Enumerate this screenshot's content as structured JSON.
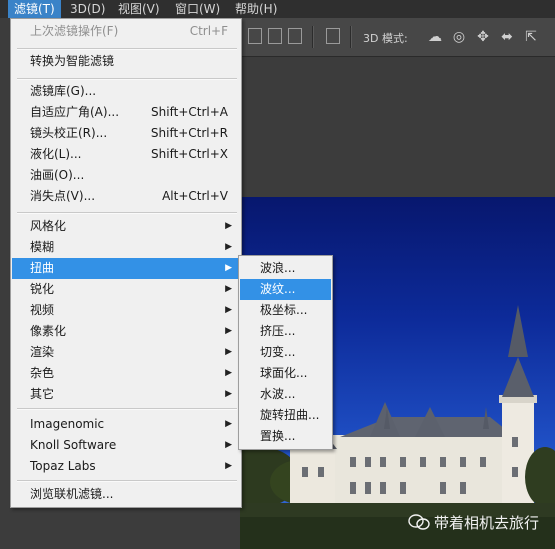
{
  "menubar": {
    "items": [
      {
        "label": "滤镜(T)",
        "active": true
      },
      {
        "label": "3D(D)"
      },
      {
        "label": "视图(V)"
      },
      {
        "label": "窗口(W)"
      },
      {
        "label": "帮助(H)"
      }
    ]
  },
  "options_bar": {
    "mode_label": "3D 模式:",
    "icons": [
      "align-icon",
      "distribute-icon",
      "rotate-3d-icon",
      "roll-3d-icon",
      "drag-3d-icon",
      "slide-3d-icon",
      "scale-3d-icon"
    ]
  },
  "filter_menu": {
    "items": [
      {
        "label": "上次滤镜操作(F)",
        "shortcut": "Ctrl+F",
        "disabled": true
      },
      {
        "label": "转换为智能滤镜"
      },
      {
        "label": "滤镜库(G)..."
      },
      {
        "label": "自适应广角(A)...",
        "shortcut": "Shift+Ctrl+A"
      },
      {
        "label": "镜头校正(R)...",
        "shortcut": "Shift+Ctrl+R"
      },
      {
        "label": "液化(L)...",
        "shortcut": "Shift+Ctrl+X"
      },
      {
        "label": "油画(O)..."
      },
      {
        "label": "消失点(V)...",
        "shortcut": "Alt+Ctrl+V"
      },
      {
        "label": "风格化",
        "submenu": true
      },
      {
        "label": "模糊",
        "submenu": true
      },
      {
        "label": "扭曲",
        "submenu": true,
        "highlighted": true
      },
      {
        "label": "锐化",
        "submenu": true
      },
      {
        "label": "视频",
        "submenu": true
      },
      {
        "label": "像素化",
        "submenu": true
      },
      {
        "label": "渲染",
        "submenu": true
      },
      {
        "label": "杂色",
        "submenu": true
      },
      {
        "label": "其它",
        "submenu": true
      },
      {
        "label": "Imagenomic",
        "submenu": true
      },
      {
        "label": "Knoll Software",
        "submenu": true
      },
      {
        "label": "Topaz Labs",
        "submenu": true
      },
      {
        "label": "浏览联机滤镜..."
      }
    ]
  },
  "distort_submenu": {
    "items": [
      {
        "label": "波浪..."
      },
      {
        "label": "波纹...",
        "highlighted": true
      },
      {
        "label": "极坐标..."
      },
      {
        "label": "挤压..."
      },
      {
        "label": "切变..."
      },
      {
        "label": "球面化..."
      },
      {
        "label": "水波..."
      },
      {
        "label": "旋转扭曲..."
      },
      {
        "label": "置换..."
      }
    ]
  },
  "watermark": {
    "text": "带着相机去旅行"
  },
  "colors": {
    "highlight": "#3391e6",
    "menubar_active": "#3a83c8",
    "sky": "#0d2b9a"
  }
}
